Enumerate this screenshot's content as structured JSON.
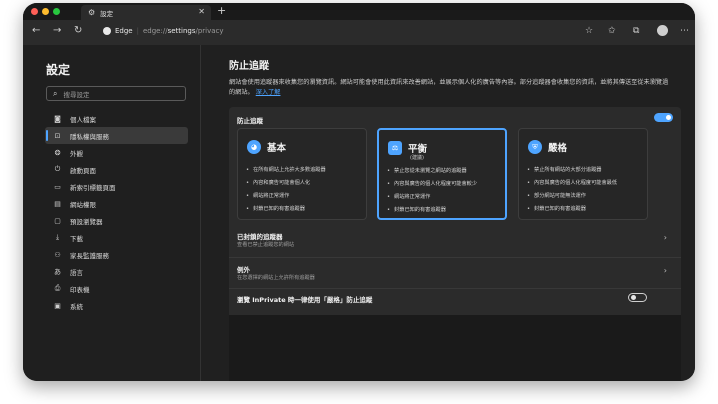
{
  "browser": {
    "tab_title": "設定",
    "address_site": "Edge",
    "address_prefix": "edge://",
    "address_bold": "settings",
    "address_suffix": "/privacy"
  },
  "sidebar": {
    "title": "設定",
    "search_placeholder": "搜尋設定",
    "items": [
      {
        "label": "個人檔案",
        "icon": "person-icon"
      },
      {
        "label": "隱私權與服務",
        "icon": "lock-icon",
        "active": true
      },
      {
        "label": "外觀",
        "icon": "appearance-icon"
      },
      {
        "label": "啟動頁面",
        "icon": "power-icon"
      },
      {
        "label": "新索引標籤頁面",
        "icon": "new-tab-icon"
      },
      {
        "label": "網站權限",
        "icon": "site-permissions-icon"
      },
      {
        "label": "預設瀏覽器",
        "icon": "browser-icon"
      },
      {
        "label": "下載",
        "icon": "download-icon"
      },
      {
        "label": "家長監護服務",
        "icon": "family-icon"
      },
      {
        "label": "語言",
        "icon": "language-icon"
      },
      {
        "label": "印表機",
        "icon": "printer-icon"
      },
      {
        "label": "系統",
        "icon": "system-icon"
      }
    ]
  },
  "main": {
    "title": "防止追蹤",
    "description": "網站會使用追蹤器來收集您的瀏覽資訊。網站可能會使用此資訊來改善網站，並展示個人化的廣告等內容。部分追蹤器會收集您的資訊，並將其傳送至從未瀏覽過的網站。",
    "learn_more": "深入了解",
    "panel_label": "防止追蹤",
    "panel_toggle_on": true,
    "cards": [
      {
        "name": "基本",
        "subtitle": "",
        "icon": "basic-icon",
        "selected": false,
        "bullets": [
          "在所有網站上允許大多數追蹤器",
          "內容和廣告可能會個人化",
          "網站將正常運作",
          "封鎖已知的有害追蹤器"
        ]
      },
      {
        "name": "平衡",
        "subtitle": "(建議)",
        "icon": "balanced-icon",
        "selected": true,
        "bullets": [
          "禁止您從未瀏覽之網站的追蹤器",
          "內容與廣告的個人化程度可能會較少",
          "網站將正常運作",
          "封鎖已知的有害追蹤器"
        ]
      },
      {
        "name": "嚴格",
        "subtitle": "",
        "icon": "strict-icon",
        "selected": false,
        "bullets": [
          "禁止所有網站的大部分追蹤器",
          "內容與廣告的個人化程度可能會最低",
          "部分網站可能無法運作",
          "封鎖已知的有害追蹤器"
        ]
      }
    ],
    "blocked_title": "已封鎖的追蹤器",
    "blocked_sub": "查看已禁止追蹤您的網站",
    "exceptions_title": "例外",
    "exceptions_sub": "在您選擇的網站上允許所有追蹤器",
    "inprivate_label": "瀏覽 InPrivate 時一律使用「嚴格」防止追蹤",
    "inprivate_toggle_on": false
  },
  "colors": {
    "accent": "#4ea4ff",
    "background": "#202020",
    "panel": "#2b2b2b"
  }
}
